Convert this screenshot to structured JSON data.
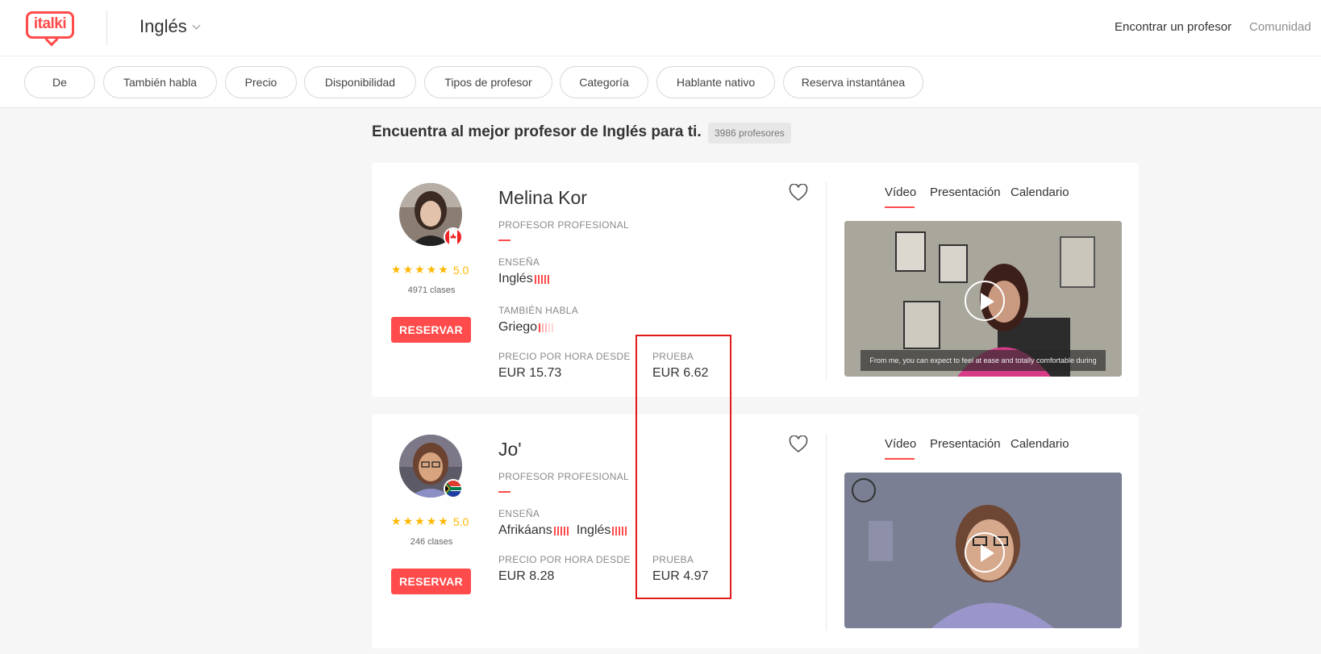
{
  "brand": {
    "logo_text": "italki",
    "accent": "#ff4b4b"
  },
  "header": {
    "language": "Inglés",
    "nav": [
      "Encontrar un profesor",
      "Comunidad"
    ]
  },
  "filters": [
    "De",
    "También habla",
    "Precio",
    "Disponibilidad",
    "Tipos de profesor",
    "Categoría",
    "Hablante nativo",
    "Reserva instantánea"
  ],
  "heading": {
    "title": "Encuentra al mejor profesor de Inglés para ti.",
    "count": "3986 profesores"
  },
  "labels": {
    "professional": "PROFESOR PROFESIONAL",
    "teaches": "ENSEÑA",
    "also_speaks": "TAMBIÉN HABLA",
    "hourly_price": "PRECIO POR HORA DESDE",
    "trial": "PRUEBA",
    "reserve": "RESERVAR"
  },
  "video_tabs": [
    "Vídeo",
    "Presentación",
    "Calendario"
  ],
  "teachers": [
    {
      "name": "Melina Kor",
      "flag": "canada-flag",
      "rating": "5.0",
      "lessons": "4971 clases",
      "teaches": [
        "Inglés"
      ],
      "also_speaks": [
        "Griego"
      ],
      "hourly_price": "EUR 15.73",
      "trial_price": "EUR 6.62",
      "video_caption": "From me, you can expect to feel at ease and totally comfortable during"
    },
    {
      "name": "Jo'",
      "flag": "south-africa-flag",
      "rating": "5.0",
      "lessons": "246 clases",
      "teaches": [
        "Afrikáans",
        "Inglés"
      ],
      "also_speaks": [],
      "hourly_price": "EUR 8.28",
      "trial_price": "EUR 4.97",
      "video_caption": ""
    }
  ]
}
